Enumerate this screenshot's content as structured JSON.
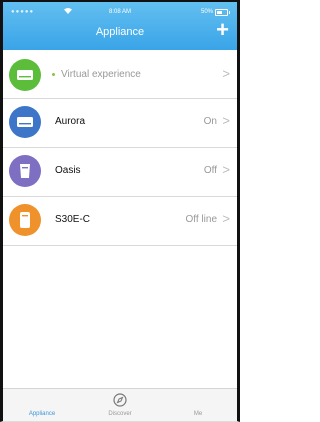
{
  "status": {
    "dots": "●●●●●",
    "time": "8:08 AM",
    "battery": "50%"
  },
  "header": {
    "title": "Appliance",
    "add_label": "+"
  },
  "devices": [
    {
      "label": "Virtual experience",
      "state": "",
      "color": "#5cbd3a",
      "icon": "ac-unit-icon"
    },
    {
      "label": "Aurora",
      "state": "On",
      "color": "#3d76c8",
      "icon": "ac-unit-icon"
    },
    {
      "label": "Oasis",
      "state": "Off",
      "color": "#7e6fc2",
      "icon": "dehumidifier-icon"
    },
    {
      "label": "S30E-C",
      "state": "Off line",
      "color": "#f0922c",
      "icon": "portable-unit-icon"
    }
  ],
  "chevron": ">",
  "tabs": [
    {
      "label": "Appliance",
      "active": true
    },
    {
      "label": "Discover",
      "active": false,
      "icon": "compass-icon"
    },
    {
      "label": "Me",
      "active": false
    }
  ]
}
